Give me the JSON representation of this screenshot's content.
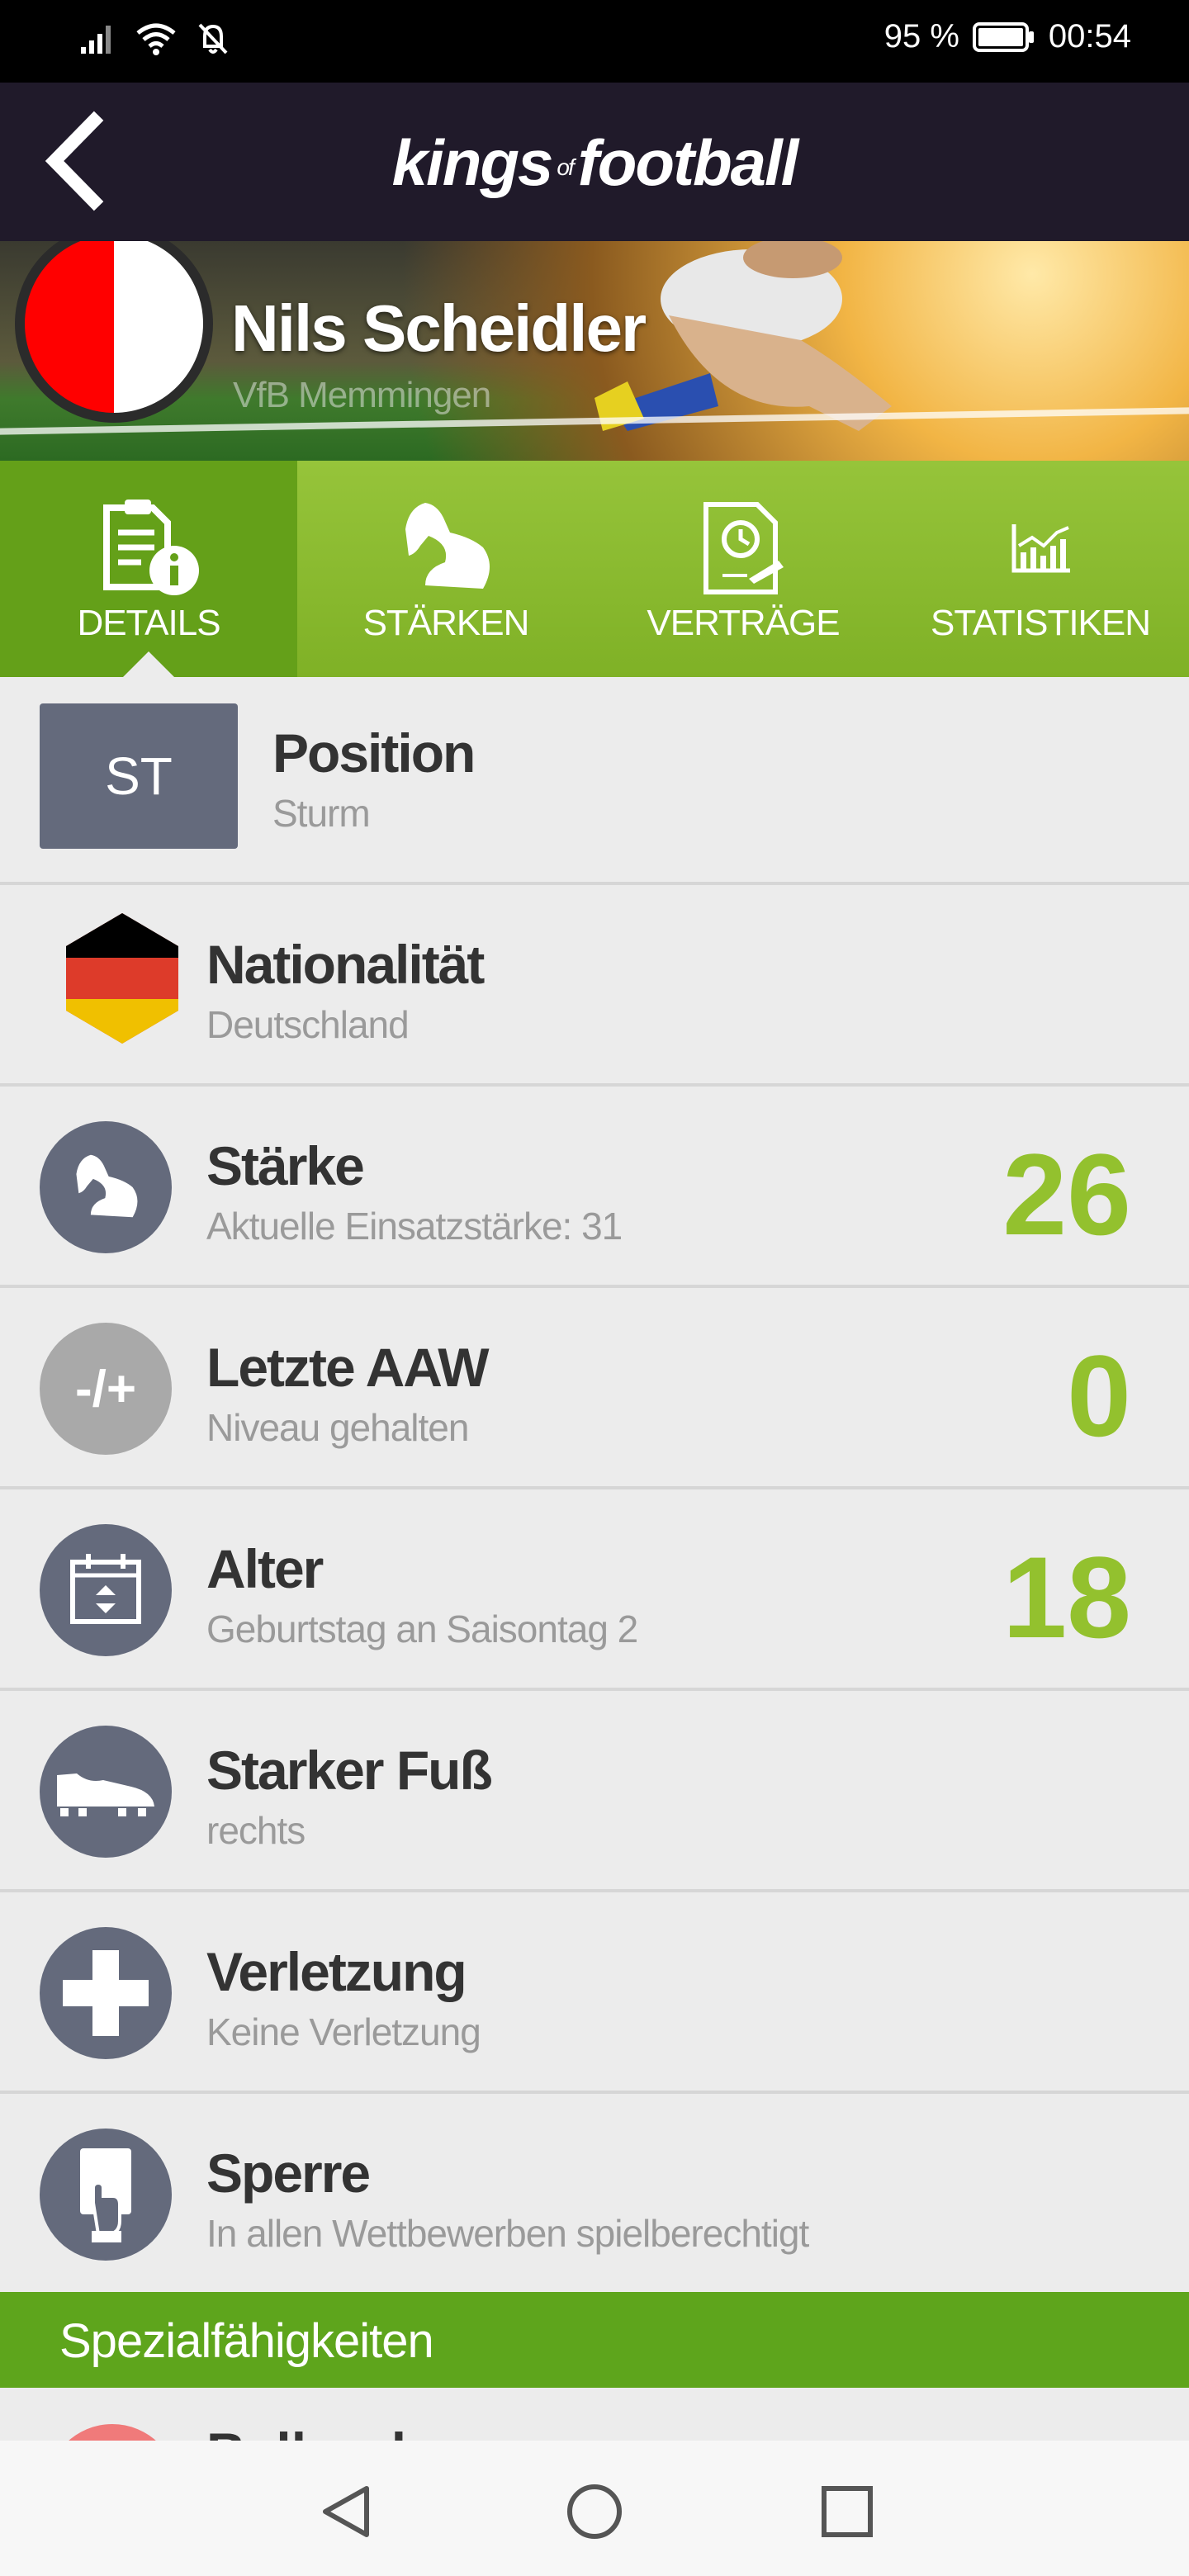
{
  "status_bar": {
    "battery_percent": "95 %",
    "time": "00:54"
  },
  "header": {
    "brand_left": "kings",
    "brand_mid": "of",
    "brand_right": "football"
  },
  "player": {
    "name": "Nils Scheidler",
    "club": "VfB Memmingen",
    "club_colors": [
      "#ff0000",
      "#ffffff"
    ]
  },
  "tabs": [
    {
      "label": "DETAILS",
      "icon": "details-icon",
      "active": true
    },
    {
      "label": "STÄRKEN",
      "icon": "muscle-icon",
      "active": false
    },
    {
      "label": "VERTRÄGE",
      "icon": "contract-icon",
      "active": false
    },
    {
      "label": "STATISTIKEN",
      "icon": "statistics-icon",
      "active": false
    }
  ],
  "details": {
    "position": {
      "badge": "ST",
      "title": "Position",
      "subtitle": "Sturm"
    },
    "nationality": {
      "title": "Nationalität",
      "subtitle": "Deutschland",
      "flag_colors": [
        "#000000",
        "#dd3b2a",
        "#f0c000"
      ]
    },
    "strength": {
      "title": "Stärke",
      "subtitle": "Aktuelle Einsatzstärke: 31",
      "value": "26"
    },
    "last_aaw": {
      "title": "Letzte AAW",
      "subtitle": "Niveau gehalten",
      "value": "0",
      "icon_text": "-/+"
    },
    "age": {
      "title": "Alter",
      "subtitle": "Geburtstag an Saisontag 2",
      "value": "18"
    },
    "strong_foot": {
      "title": "Starker Fuß",
      "subtitle": "rechts"
    },
    "injury": {
      "title": "Verletzung",
      "subtitle": "Keine Verletzung"
    },
    "suspension": {
      "title": "Sperre",
      "subtitle": "In allen Wettbewerben spielberechtigt"
    }
  },
  "special": {
    "header": "Spezialfähigkeiten",
    "first_item_partial": "Balleroberer"
  },
  "colors": {
    "accent_green": "#93c12e",
    "tab_green": "#8dbd2f",
    "tab_active": "#64a019",
    "icon_bg": "#646a7c",
    "header_bg": "#201a2a"
  }
}
